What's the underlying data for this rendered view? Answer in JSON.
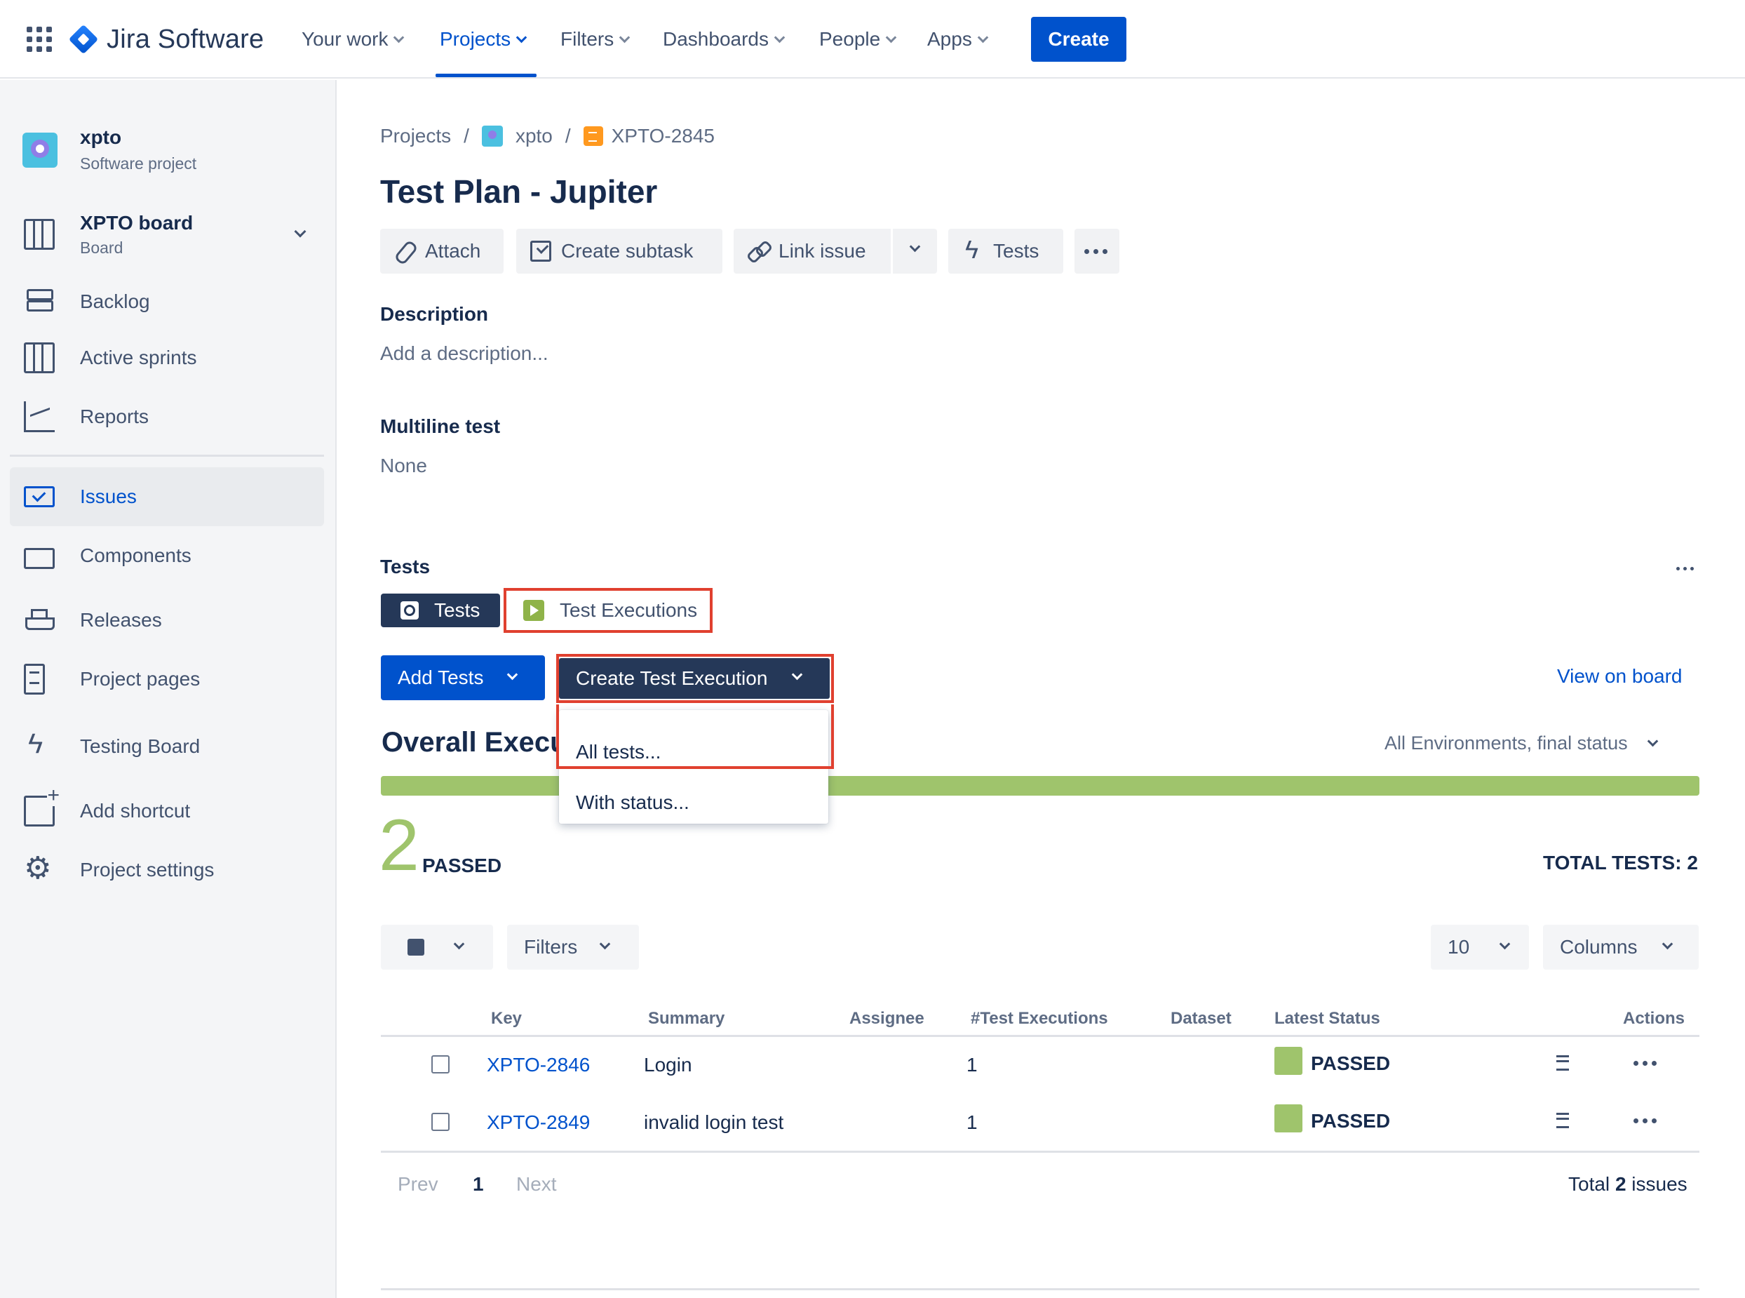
{
  "topnav": {
    "app_name": "Jira Software",
    "items": [
      "Your work",
      "Projects",
      "Filters",
      "Dashboards",
      "People",
      "Apps"
    ],
    "active": "Projects",
    "create_label": "Create"
  },
  "sidebar": {
    "project_name": "xpto",
    "project_type": "Software project",
    "board_name": "XPTO board",
    "board_type": "Board",
    "items": [
      "Backlog",
      "Active sprints",
      "Reports",
      "Issues",
      "Components",
      "Releases",
      "Project pages",
      "Testing Board",
      "Add shortcut",
      "Project settings"
    ],
    "selected": "Issues"
  },
  "breadcrumb": {
    "root": "Projects",
    "project": "xpto",
    "issue": "XPTO-2845"
  },
  "issue": {
    "title": "Test Plan - Jupiter",
    "toolbar": {
      "attach": "Attach",
      "subtask": "Create subtask",
      "link": "Link issue",
      "tests": "Tests"
    },
    "description_label": "Description",
    "description_placeholder": "Add a description...",
    "multiline_label": "Multiline test",
    "multiline_value": "None"
  },
  "tests_panel": {
    "heading": "Tests",
    "tabs": [
      "Tests",
      "Test Executions"
    ],
    "add_tests": "Add Tests",
    "create_exec": "Create Test Execution",
    "menu_items": [
      "All tests...",
      "With status..."
    ],
    "view_on_board": "View on board",
    "overall_heading": "Overall Execut",
    "environment": "All Environments, final status",
    "progress_passed_fraction": 1.0,
    "passed_count": "2",
    "passed_label": "PASSED",
    "total_tests": "TOTAL TESTS: 2",
    "filters_label": "Filters",
    "page_size": "10",
    "columns_label": "Columns",
    "columns": [
      "Key",
      "Summary",
      "Assignee",
      "#Test Executions",
      "Dataset",
      "Latest Status",
      "Actions"
    ],
    "rows": [
      {
        "key": "XPTO-2846",
        "summary": "Login",
        "executions": "1",
        "status": "PASSED"
      },
      {
        "key": "XPTO-2849",
        "summary": "invalid login test",
        "executions": "1",
        "status": "PASSED"
      }
    ],
    "pagination": {
      "prev": "Prev",
      "page": "1",
      "next": "Next",
      "total_prefix": "Total",
      "total_count": "2",
      "total_suffix": "issues"
    },
    "colors": {
      "passed": "#9fc46c",
      "primary": "#0052cc",
      "dark": "#253858",
      "highlight": "#e0402f"
    }
  }
}
